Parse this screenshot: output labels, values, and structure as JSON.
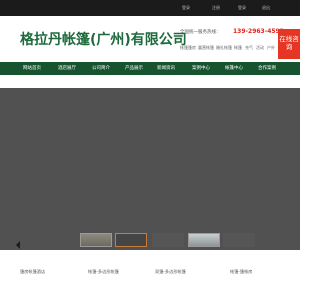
{
  "topbar": {
    "links": [
      "登录",
      "注册",
      "登录",
      "退出"
    ]
  },
  "header": {
    "title": "格拉丹帐篷(广州)有限公司",
    "hotline_label": "全国统一服务热线：",
    "hotline_number": "139-2963-4593",
    "keywords": [
      "帐篷篷房",
      "露营帐篷",
      "婚礼帐篷",
      "帐篷",
      "充气",
      "活动",
      "户外"
    ]
  },
  "consult": {
    "label": "在线咨询"
  },
  "nav": {
    "items": [
      "网站首页",
      "酒店展厅",
      "公司简介",
      "产品展示",
      "新闻资讯",
      "案例中心",
      "帐篷中心",
      "合作案例"
    ]
  },
  "categories": [
    "篷房帐篷酒店",
    "帐篷-多边形帐篷",
    "双篷-多边形帐篷",
    "帐篷-篷帐房"
  ],
  "colors": {
    "brand_green": "#1e6a3d",
    "nav_bg": "#17532f",
    "accent_red": "#e53524"
  }
}
